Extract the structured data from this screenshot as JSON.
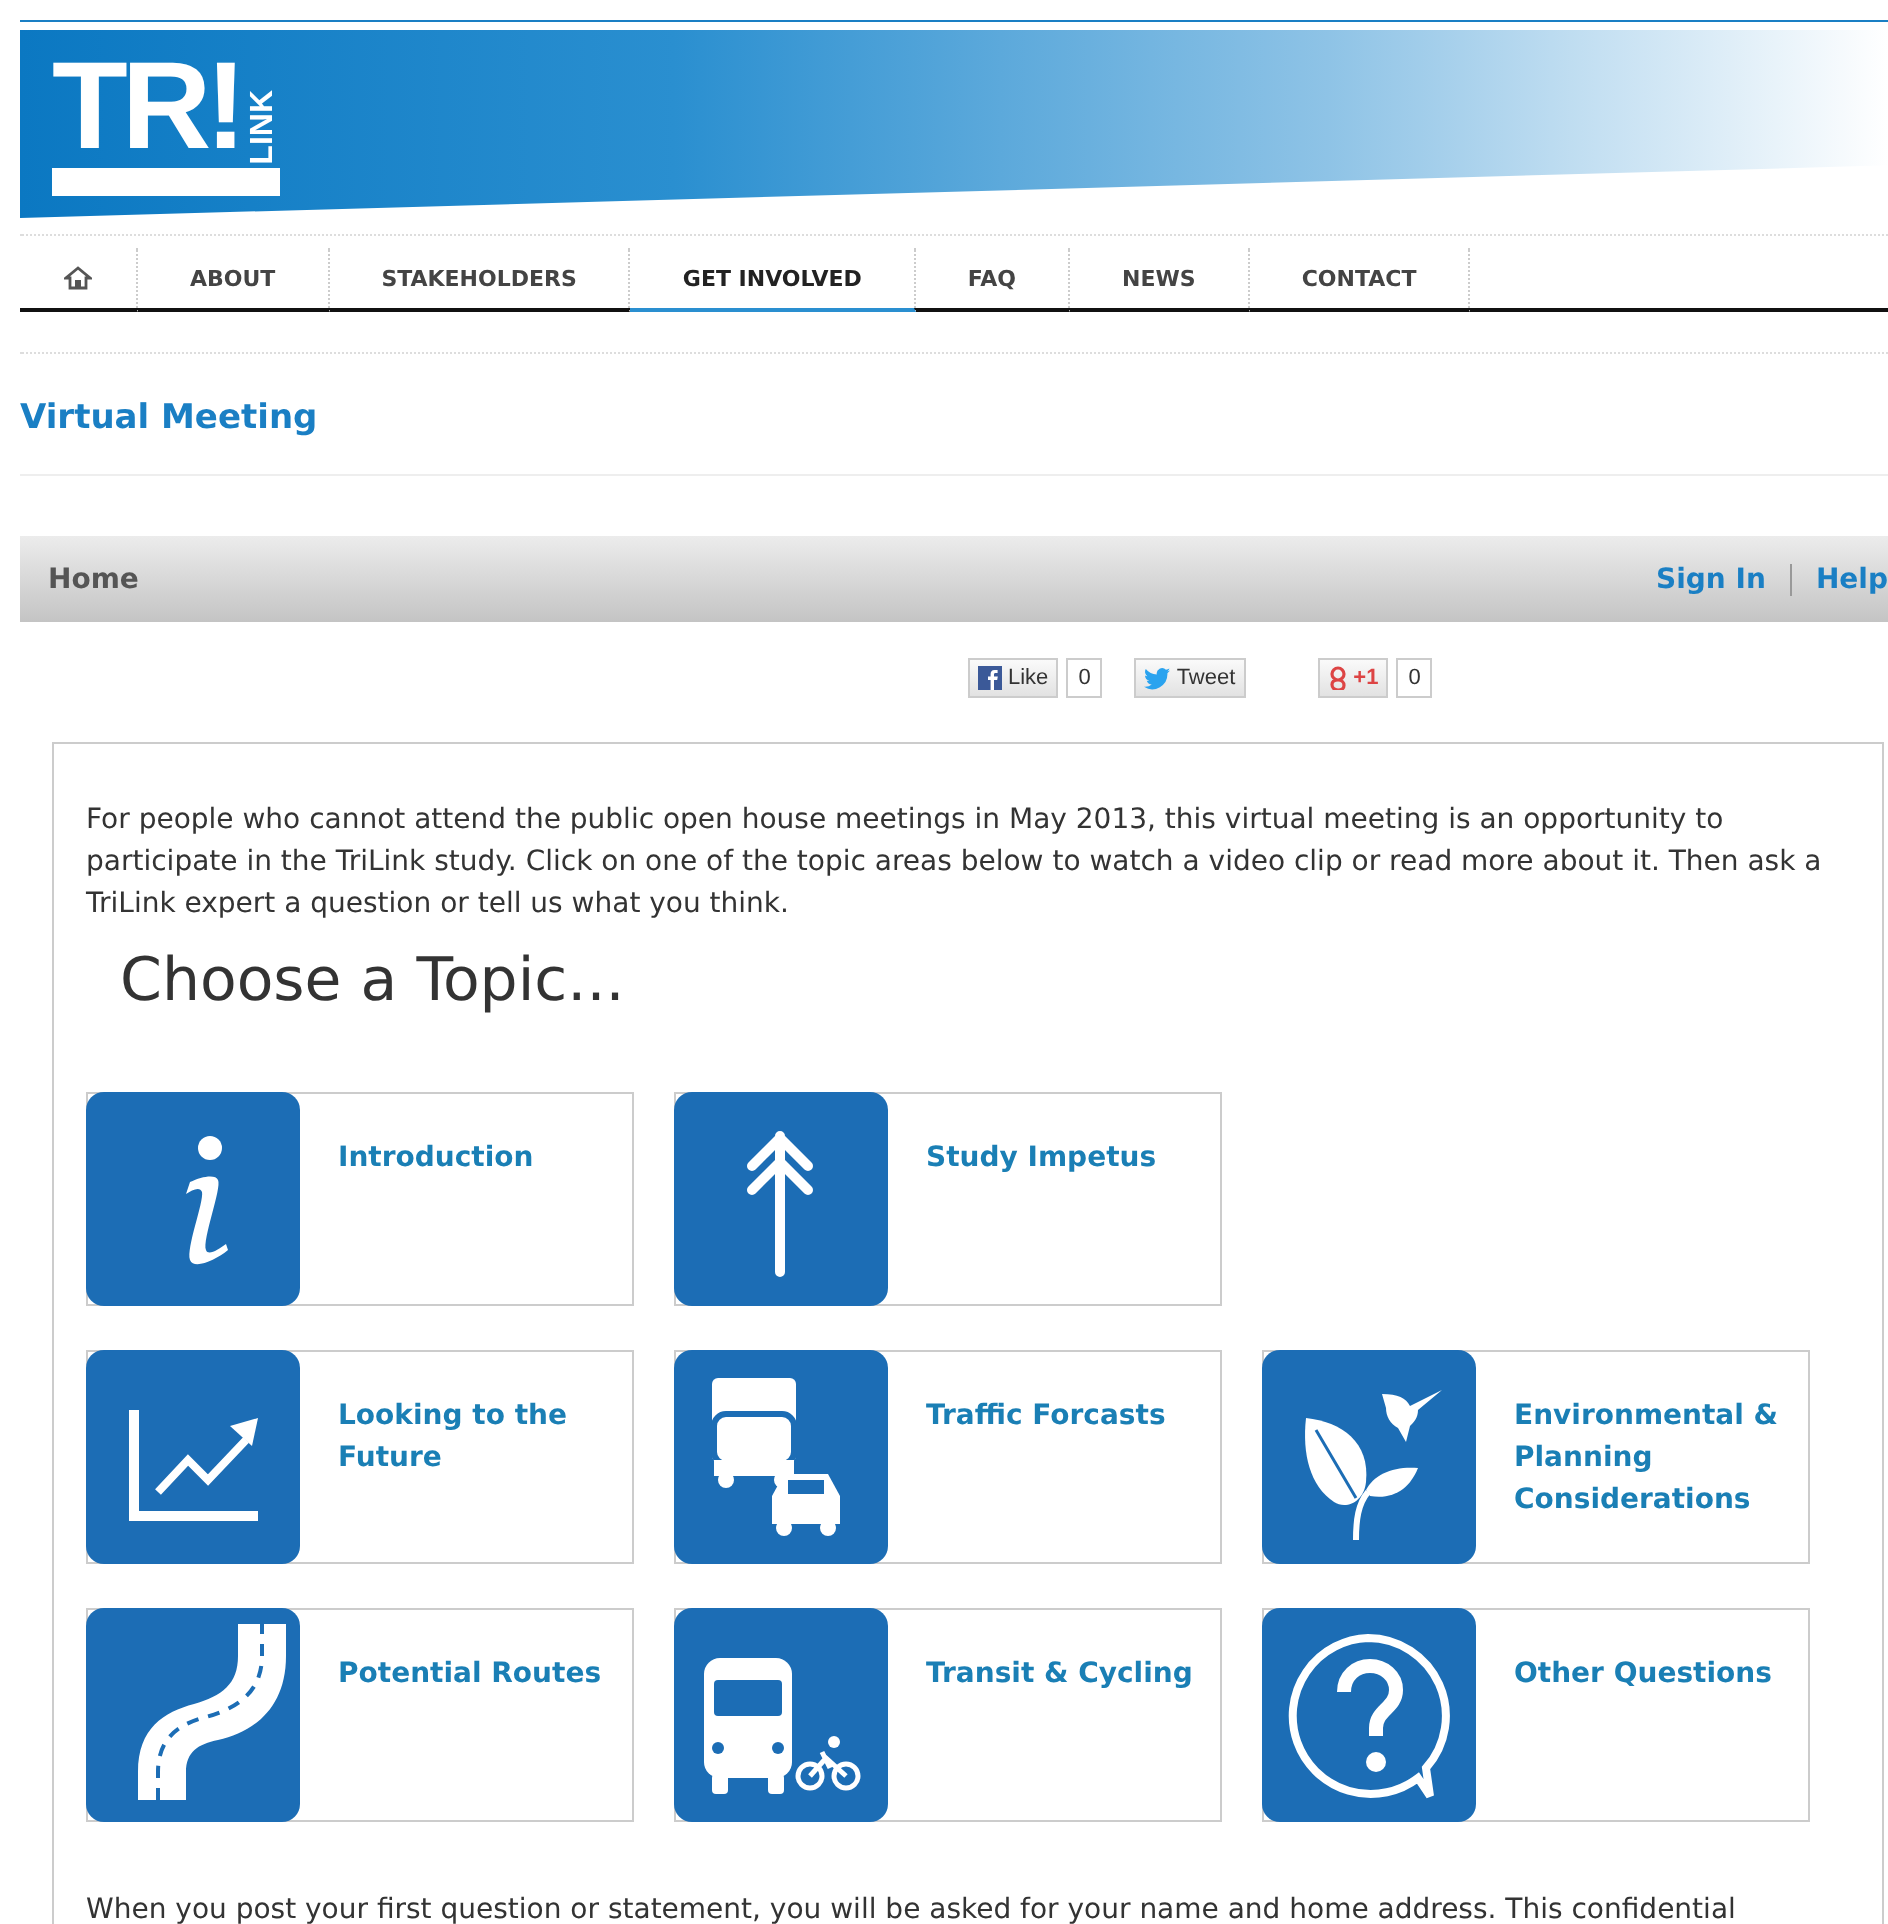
{
  "logo": {
    "letters": "TR!",
    "side": "LINK"
  },
  "nav": [
    {
      "kind": "home",
      "selected": false
    },
    {
      "kind": "text",
      "label": "ABOUT",
      "selected": false
    },
    {
      "kind": "text",
      "label": "STAKEHOLDERS",
      "selected": false
    },
    {
      "kind": "text",
      "label": "GET INVOLVED",
      "selected": true
    },
    {
      "kind": "text",
      "label": "FAQ",
      "selected": false
    },
    {
      "kind": "text",
      "label": "NEWS",
      "selected": false
    },
    {
      "kind": "text",
      "label": "CONTACT",
      "selected": false
    }
  ],
  "page_title": "Virtual Meeting",
  "breadcrumb_bar": {
    "home": "Home",
    "links": [
      "Sign In",
      "Help"
    ]
  },
  "social": [
    {
      "kind": "facebook",
      "label": "Like",
      "count": "0"
    },
    {
      "kind": "twitter",
      "label": "Tweet"
    },
    {
      "kind": "google",
      "label": "+1",
      "count": "0"
    }
  ],
  "intro": "For people who cannot attend the public open house meetings in May 2013, this virtual meeting is an opportunity to participate in the TriLink study.  Click on one of the topic areas below to watch a video clip or read more about it.  Then ask a TriLink expert a question or tell us what you think.",
  "heading": "Choose a Topic...",
  "topics": [
    [
      {
        "kind": "info",
        "title": "Introduction"
      },
      {
        "kind": "arrow",
        "title": "Study Impetus"
      }
    ],
    [
      {
        "kind": "chart",
        "title": "Looking to the Future"
      },
      {
        "kind": "traffic",
        "title": "Traffic Forcasts"
      },
      {
        "kind": "leaf",
        "title": "Environmental & Planning Considerations"
      }
    ],
    [
      {
        "kind": "road",
        "title": "Potential Routes"
      },
      {
        "kind": "bus",
        "title": "Transit & Cycling"
      },
      {
        "kind": "question",
        "title": "Other Questions"
      }
    ]
  ],
  "footer_note": "When you post your first question or statement, you will be asked for your name and home address. This confidential"
}
